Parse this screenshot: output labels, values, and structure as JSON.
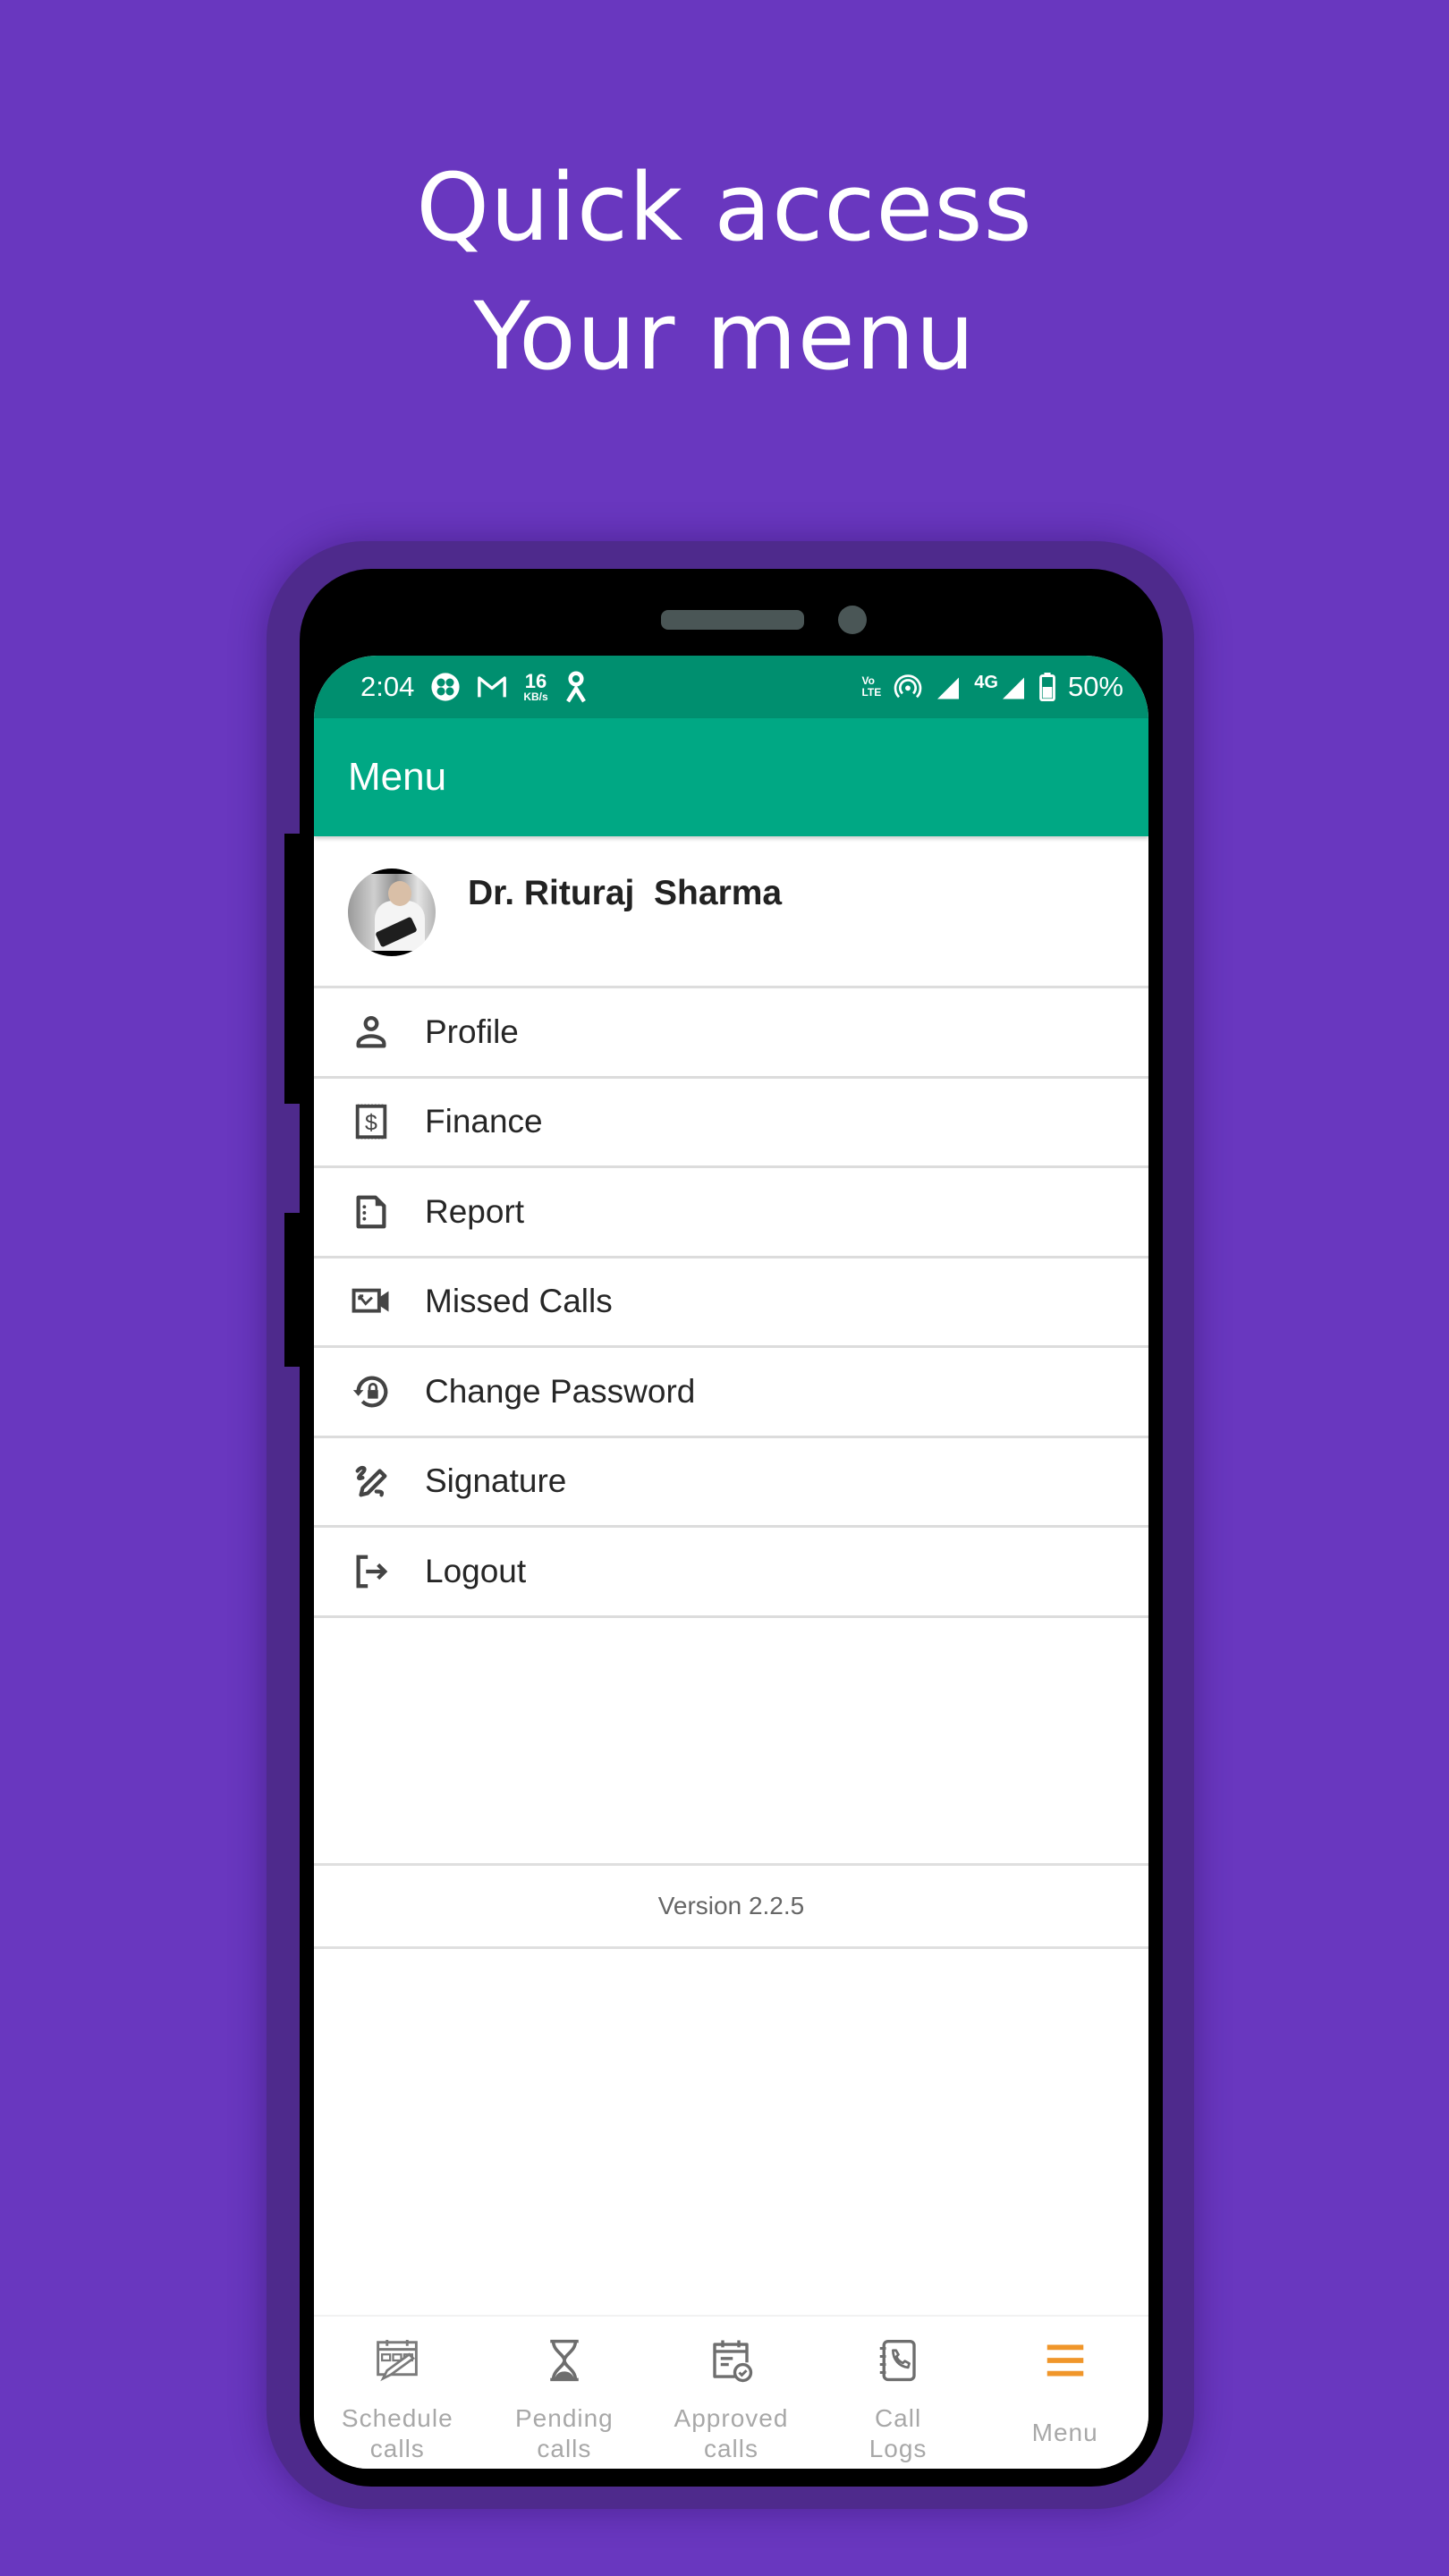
{
  "headline": {
    "line1": "Quick access",
    "line2": "Your menu"
  },
  "colors": {
    "background": "#6937BF",
    "status_bar": "#008F6F",
    "app_bar": "#00A884",
    "active_nav": "#F0962A",
    "inactive_nav": "#A8A8A8"
  },
  "status_bar": {
    "time": "2:04",
    "speed_value": "16",
    "speed_unit": "KB/s",
    "volte_top": "Vo",
    "volte_bottom": "LTE",
    "network_type": "4G",
    "battery": "50%",
    "icons": [
      "fan-app-icon",
      "gmail-icon",
      "data-speed",
      "person-app-icon",
      "volte-icon",
      "hotspot-icon",
      "signal-icon",
      "signal-4g-icon",
      "battery-icon"
    ]
  },
  "app_bar": {
    "title": "Menu"
  },
  "profile": {
    "name": "Dr. Rituraj  Sharma"
  },
  "menu": {
    "items": [
      {
        "label": "Profile",
        "icon": "person-icon"
      },
      {
        "label": "Finance",
        "icon": "receipt-dollar-icon"
      },
      {
        "label": "Report",
        "icon": "report-icon"
      },
      {
        "label": "Missed Calls",
        "icon": "missed-video-call-icon"
      },
      {
        "label": "Change Password",
        "icon": "lock-reset-icon"
      },
      {
        "label": "Signature",
        "icon": "signature-icon"
      },
      {
        "label": "Logout",
        "icon": "logout-icon"
      }
    ]
  },
  "version": "Version 2.2.5",
  "bottom_nav": {
    "items": [
      {
        "line1": "Schedule",
        "line2": "calls",
        "icon": "schedule-calendar-icon",
        "active": false
      },
      {
        "line1": "Pending",
        "line2": "calls",
        "icon": "hourglass-icon",
        "active": false
      },
      {
        "line1": "Approved",
        "line2": "calls",
        "icon": "calendar-check-icon",
        "active": false
      },
      {
        "line1": "Call",
        "line2": "Logs",
        "icon": "phone-book-icon",
        "active": false
      },
      {
        "line1": "Menu",
        "line2": "",
        "icon": "hamburger-icon",
        "active": true
      }
    ]
  }
}
